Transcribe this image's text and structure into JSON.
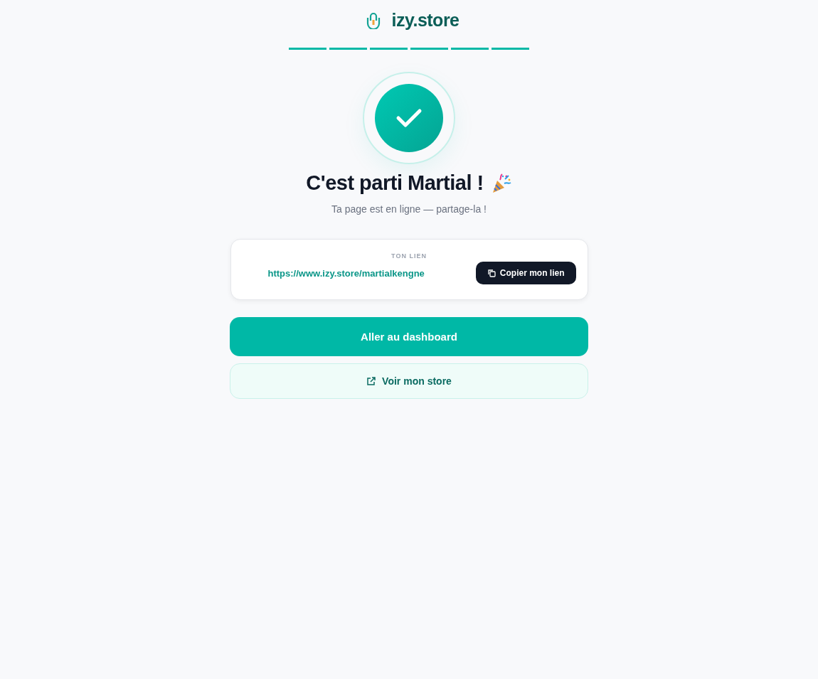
{
  "brand": {
    "name": "izy.store"
  },
  "steps": [
    {
      "done": true
    },
    {
      "done": true
    },
    {
      "done": true
    },
    {
      "done": true
    },
    {
      "done": true
    },
    {
      "done": true
    }
  ],
  "success": {
    "title": "C'est parti Martial !",
    "subtitle": "Ta page est en ligne — partage-la !"
  },
  "link_card": {
    "label": "TON LIEN",
    "url": "https://www.izy.store/martialkengne",
    "copy_button": "Copier mon lien"
  },
  "actions": [
    {
      "kind": "primary",
      "label": "Aller au dashboard"
    },
    {
      "kind": "secondary",
      "label": "Voir mon store"
    }
  ]
}
